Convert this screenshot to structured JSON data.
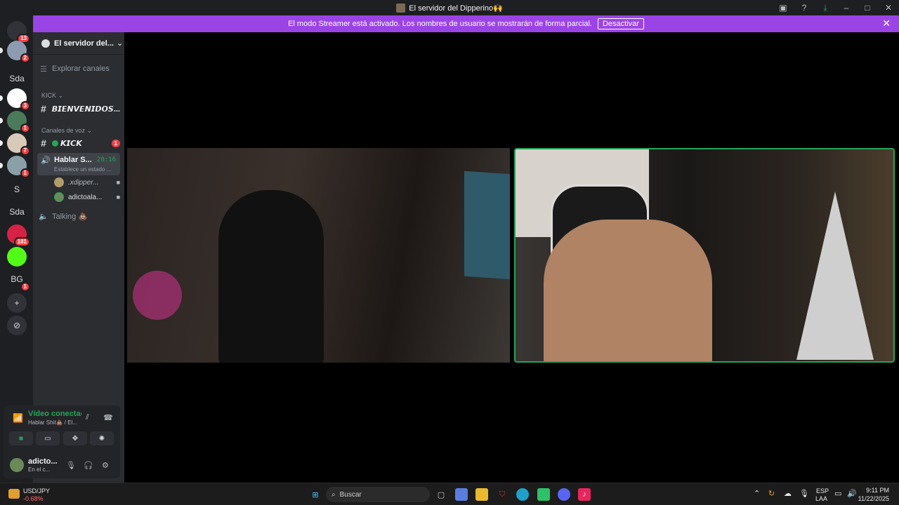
{
  "window": {
    "title": "El servidor del Dipperino🙌"
  },
  "banner": {
    "text": "El modo Streamer está activado. Los nombres de usuario se mostrarán de forma parcial.",
    "button": "Desactivar"
  },
  "guilds": [
    {
      "label": "",
      "badge": "13",
      "color": "#313338",
      "icon": "discord-home-icon"
    },
    {
      "label": "",
      "badge": "2",
      "color": "#8d9bb0",
      "icon": "server-avatar-icon"
    },
    {
      "label": "Sda",
      "badge": "",
      "color": "#1e1f22"
    },
    {
      "label": "",
      "badge": "3",
      "color": "#ffffff"
    },
    {
      "label": "",
      "badge": "1",
      "color": "#4a7a5a"
    },
    {
      "label": "",
      "badge": "7",
      "color": "#d9c9b8"
    },
    {
      "label": "",
      "badge": "1",
      "color": "#8aa0a8"
    },
    {
      "label": "S",
      "badge": "",
      "color": "#1e1f22"
    },
    {
      "label": "Sda",
      "badge": "",
      "color": "#1e1f22"
    },
    {
      "label": "",
      "badge": "181",
      "color": "#d62246"
    },
    {
      "label": "",
      "badge": "",
      "color": "#53fc18"
    },
    {
      "label": "BG",
      "badge": "1",
      "color": "#1e1f22"
    },
    {
      "label": "+",
      "badge": "",
      "color": "#313338"
    },
    {
      "label": "⊘",
      "badge": "",
      "color": "#313338"
    }
  ],
  "sidebar": {
    "server_name": "El servidor del...",
    "explore": "Explorar canales",
    "category_kick": "KICK",
    "channel_welcome": "𝘽𝙄𝙀𝙉𝙑𝙀𝙉𝙄𝘿𝙊𝙎...",
    "category_voice": "Canales de voz",
    "channel_kick": "𝙆𝙄𝘾𝙆",
    "channel_kick_badge": "1",
    "voice_channel": {
      "name": "Hablar S...",
      "time": "20:16",
      "status": "Establece un estado ..."
    },
    "voice_users": [
      {
        "name": ".xdipper...",
        "color": "#b39c6b"
      },
      {
        "name": "adictoala...",
        "color": "#6b8a5a"
      }
    ],
    "talking": "Talking 💩"
  },
  "voice_panel": {
    "connected": "Vídeo conectado",
    "subtitle": "Hablar Shit💩 / El...",
    "buttons": [
      "camera",
      "screen",
      "activities",
      "soundboard"
    ],
    "me_name": "adicto...",
    "me_status": "En el c..."
  },
  "taskbar": {
    "stock_symbol": "USD/JPY",
    "stock_change": "-0.68%",
    "search": "Buscar",
    "lang1": "ESP",
    "lang2": "LAA",
    "time": "9:11 PM",
    "date": "11/22/2025"
  },
  "colors": {
    "accent_green": "#23a55a",
    "banner_purple": "#9b44e6",
    "danger": "#f23f43"
  }
}
